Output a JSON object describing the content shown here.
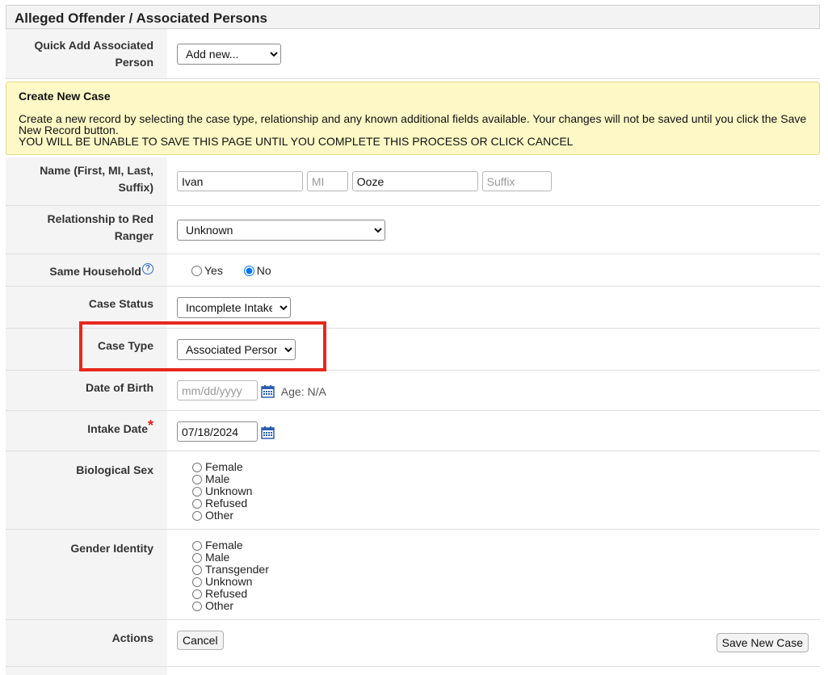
{
  "panel": {
    "title": "Alleged Offender / Associated Persons"
  },
  "quick_add": {
    "label": "Quick Add Associated Person",
    "selected": "Add new..."
  },
  "notice": {
    "title": "Create New Case",
    "body": "Create a new record by selecting the case type, relationship and any known additional fields available. Your changes will not be saved until you click the Save New Record button.",
    "warning": "YOU WILL BE UNABLE TO SAVE THIS PAGE UNTIL YOU COMPLETE THIS PROCESS OR CLICK CANCEL"
  },
  "name": {
    "label": "Name (First, MI, Last, Suffix)",
    "first": "Ivan",
    "mi_placeholder": "MI",
    "last": "Ooze",
    "suffix_placeholder": "Suffix"
  },
  "relationship": {
    "label": "Relationship to Red Ranger",
    "selected": "Unknown"
  },
  "household": {
    "label": "Same Household",
    "help": "?",
    "options": [
      "Yes",
      "No"
    ],
    "selected": "No"
  },
  "case_status": {
    "label": "Case Status",
    "selected": "Incomplete Intake"
  },
  "case_type": {
    "label": "Case Type",
    "selected": "Associated Person"
  },
  "dob": {
    "label": "Date of Birth",
    "placeholder": "mm/dd/yyyy",
    "age": "Age: N/A"
  },
  "intake": {
    "label": "Intake Date",
    "required": "*",
    "value": "07/18/2024"
  },
  "bio_sex": {
    "label": "Biological Sex",
    "options": [
      "Female",
      "Male",
      "Unknown",
      "Refused",
      "Other"
    ]
  },
  "gender": {
    "label": "Gender Identity",
    "options": [
      "Female",
      "Male",
      "Transgender",
      "Unknown",
      "Refused",
      "Other"
    ]
  },
  "actions": {
    "label": "Actions",
    "cancel": "Cancel",
    "save": "Save New Case"
  },
  "colors": {
    "highlight": "#e8271d",
    "notice_bg": "#fdf8c6",
    "label_bg": "#f4f4f4"
  }
}
